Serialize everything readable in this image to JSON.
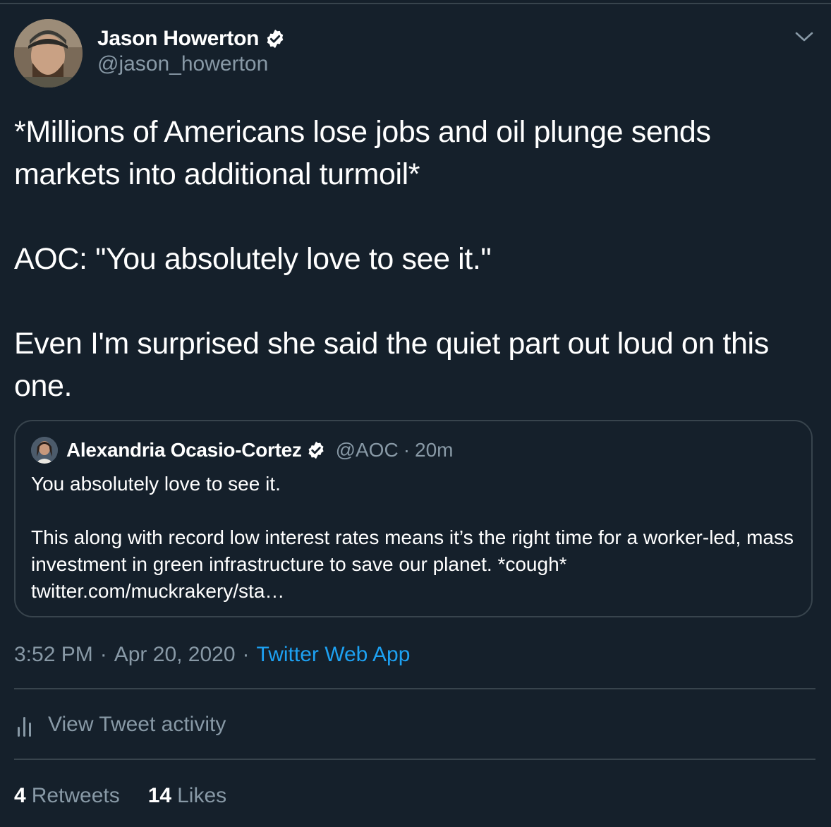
{
  "tweet": {
    "author": {
      "name": "Jason Howerton",
      "handle": "@jason_howerton",
      "verified": true
    },
    "text_lines": [
      "*Millions of Americans lose jobs and oil plunge sends markets into additional turmoil*",
      "AOC: \"You absolutely love to see it.\"",
      "Even I'm surprised she said the quiet part out loud on this one."
    ],
    "quoted": {
      "author_name": "Alexandria Ocasio-Cortez",
      "handle": "@AOC",
      "separator": "·",
      "time": "20m",
      "verified": true,
      "line1": "You absolutely love to see it.",
      "line2": "This along with record low interest rates means it’s the right time for a worker-led, mass investment in green infrastructure to save our planet. *cough* twitter.com/muckrakery/sta…"
    },
    "meta": {
      "time": "3:52 PM",
      "separator": "·",
      "date": "Apr 20, 2020",
      "source": "Twitter Web App"
    },
    "activity_label": "View Tweet activity",
    "stats": {
      "retweets_count": "4",
      "retweets_label": "Retweets",
      "likes_count": "14",
      "likes_label": "Likes"
    }
  },
  "icons": {
    "verified": "verified-badge-icon",
    "caret": "chevron-down-icon",
    "activity": "bar-chart-icon"
  },
  "colors": {
    "background": "#15202b",
    "border": "#38444d",
    "secondary_text": "#8899a6",
    "link": "#1da1f2",
    "primary_text": "#ffffff"
  }
}
